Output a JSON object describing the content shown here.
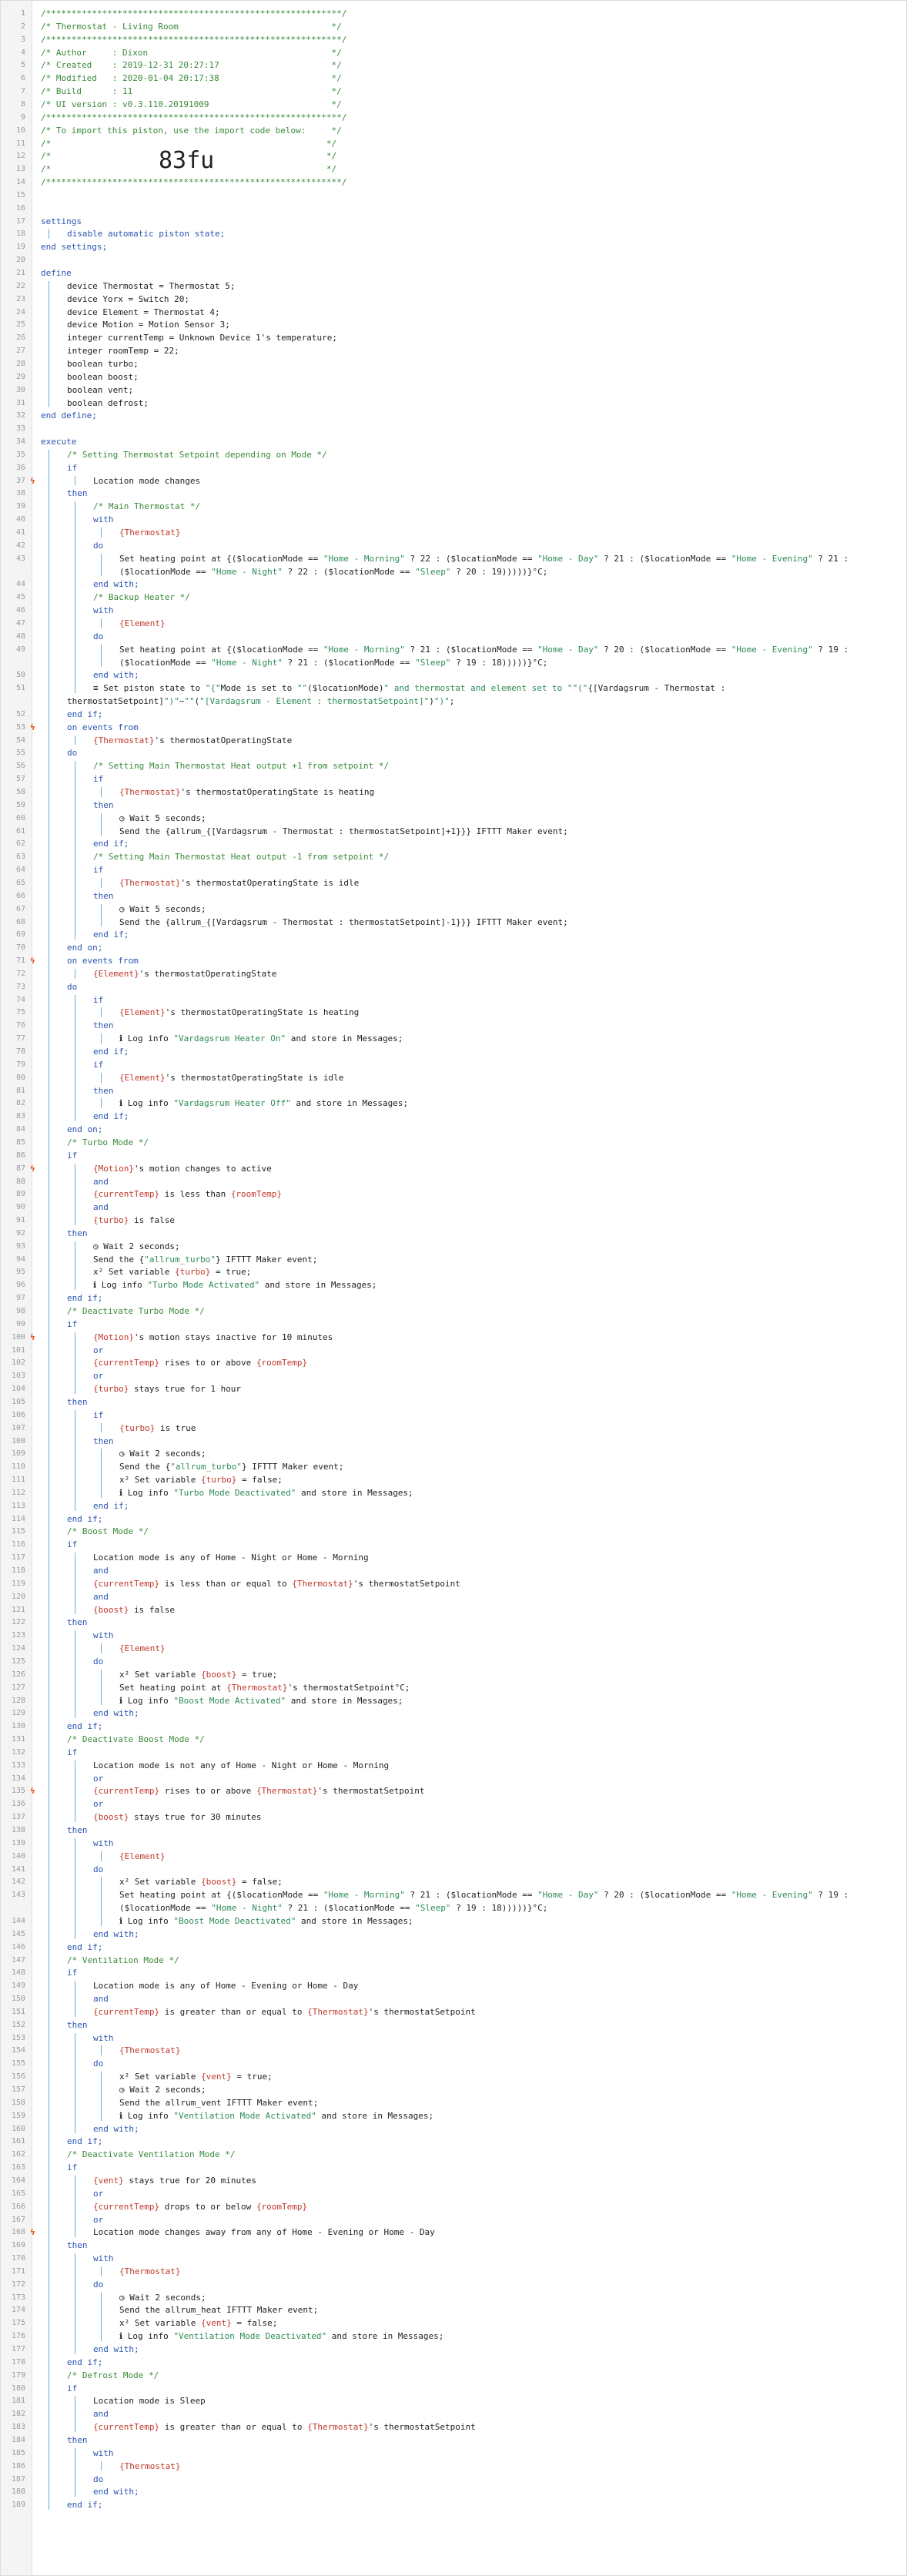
{
  "piston": {
    "title": "Thermostat - Living Room",
    "author": "Dixon",
    "created": "2019-12-31 20:27:17",
    "modified": "2020-01-04 20:17:38",
    "build": "11",
    "ui_version": "v0.3.110.20191009",
    "import_code": "83fu"
  },
  "lines": [
    {
      "n": "1",
      "ind": 0,
      "t": "/**********************************************************/",
      "c": "comment"
    },
    {
      "n": "2",
      "ind": 0,
      "t": "/* Thermostat - Living Room                              */",
      "c": "comment"
    },
    {
      "n": "3",
      "ind": 0,
      "t": "/**********************************************************/",
      "c": "comment"
    },
    {
      "n": "4",
      "ind": 0,
      "t": "/* Author     : Dixon                                    */",
      "c": "comment"
    },
    {
      "n": "5",
      "ind": 0,
      "t": "/* Created    : 2019-12-31 20:27:17                      */",
      "c": "comment"
    },
    {
      "n": "6",
      "ind": 0,
      "t": "/* Modified   : 2020-01-04 20:17:38                      */",
      "c": "comment"
    },
    {
      "n": "7",
      "ind": 0,
      "t": "/* Build      : 11                                       */",
      "c": "comment"
    },
    {
      "n": "8",
      "ind": 0,
      "t": "/* UI version : v0.3.110.20191009                        */",
      "c": "comment"
    },
    {
      "n": "9",
      "ind": 0,
      "t": "/**********************************************************/",
      "c": "comment"
    },
    {
      "n": "10",
      "ind": 0,
      "t": "/* To import this piston, use the import code below:     */",
      "c": "comment"
    },
    {
      "n": "11",
      "ind": 0,
      "t": "/*                                                      */",
      "c": "comment"
    },
    {
      "n": "12",
      "ind": 0,
      "t": "/*                                                      */",
      "c": "comment"
    },
    {
      "n": "13",
      "ind": 0,
      "t": "/*                                                      */",
      "c": "comment"
    },
    {
      "n": "14",
      "ind": 0,
      "t": "/**********************************************************/",
      "c": "comment"
    },
    {
      "n": "15",
      "ind": 0,
      "t": ""
    },
    {
      "n": "16",
      "ind": 0,
      "t": ""
    },
    {
      "n": "17",
      "ind": 0,
      "t": "settings",
      "c": "kw"
    },
    {
      "n": "18",
      "ind": 1,
      "t": "disable automatic piston state;",
      "c": "kw"
    },
    {
      "n": "19",
      "ind": 0,
      "t": "end settings;",
      "c": "kw"
    },
    {
      "n": "20",
      "ind": 0,
      "t": ""
    },
    {
      "n": "21",
      "ind": 0,
      "t": "define",
      "c": "kw"
    },
    {
      "n": "22",
      "ind": 1,
      "t": "device Thermostat = Thermostat 5;"
    },
    {
      "n": "23",
      "ind": 1,
      "t": "device Yorx = Switch 20;"
    },
    {
      "n": "24",
      "ind": 1,
      "t": "device Element = Thermostat 4;"
    },
    {
      "n": "25",
      "ind": 1,
      "t": "device Motion = Motion Sensor 3;"
    },
    {
      "n": "26",
      "ind": 1,
      "t": "integer currentTemp = Unknown Device 1's temperature;"
    },
    {
      "n": "27",
      "ind": 1,
      "t": "integer roomTemp = 22;"
    },
    {
      "n": "28",
      "ind": 1,
      "t": "boolean turbo;"
    },
    {
      "n": "29",
      "ind": 1,
      "t": "boolean boost;"
    },
    {
      "n": "30",
      "ind": 1,
      "t": "boolean vent;"
    },
    {
      "n": "31",
      "ind": 1,
      "t": "boolean defrost;"
    },
    {
      "n": "32",
      "ind": 0,
      "t": "end define;",
      "c": "kw"
    },
    {
      "n": "33",
      "ind": 0,
      "t": ""
    },
    {
      "n": "34",
      "ind": 0,
      "t": "execute",
      "c": "kw"
    },
    {
      "n": "35",
      "ind": 1,
      "t": "/* Setting Thermostat Setpoint depending on Mode */",
      "c": "comment"
    },
    {
      "n": "36",
      "ind": 1,
      "t": "if",
      "c": "kw"
    },
    {
      "n": "37",
      "ind": 2,
      "t": "Location mode changes",
      "m": "ϟ"
    },
    {
      "n": "38",
      "ind": 1,
      "t": "then",
      "c": "kw"
    },
    {
      "n": "39",
      "ind": 2,
      "t": "/* Main Thermostat */",
      "c": "comment"
    },
    {
      "n": "40",
      "ind": 2,
      "t": "with",
      "c": "kw"
    },
    {
      "n": "41",
      "ind": 3,
      "t": "{Thermostat}",
      "c": "var"
    },
    {
      "n": "42",
      "ind": 2,
      "t": "do",
      "c": "kw"
    },
    {
      "n": "43",
      "ind": 3,
      "t": "Set heating point at {($locationMode == \"Home - Morning\" ? 22 : ($locationMode == \"Home - Day\" ? 21 : ($locationMode == \"Home - Evening\" ? 21 :"
    },
    {
      "n": "",
      "ind": 3,
      "t": "($locationMode == \"Home - Night\" ? 22 : ($locationMode == \"Sleep\" ? 20 : 19)))))}°C;"
    },
    {
      "n": "44",
      "ind": 2,
      "t": "end with;",
      "c": "kw"
    },
    {
      "n": "45",
      "ind": 2,
      "t": "/* Backup Heater */",
      "c": "comment"
    },
    {
      "n": "46",
      "ind": 2,
      "t": "with",
      "c": "kw"
    },
    {
      "n": "47",
      "ind": 3,
      "t": "{Element}",
      "c": "var"
    },
    {
      "n": "48",
      "ind": 2,
      "t": "do",
      "c": "kw"
    },
    {
      "n": "49",
      "ind": 3,
      "t": "Set heating point at {($locationMode == \"Home - Morning\" ? 21 : ($locationMode == \"Home - Day\" ? 20 : ($locationMode == \"Home - Evening\" ? 19 :"
    },
    {
      "n": "",
      "ind": 3,
      "t": "($locationMode == \"Home - Night\" ? 21 : ($locationMode == \"Sleep\" ? 19 : 18)))))}°C;"
    },
    {
      "n": "50",
      "ind": 2,
      "t": "end with;",
      "c": "kw"
    },
    {
      "n": "51",
      "ind": 2,
      "t": "≡ Set piston state to \"{\"Mode is set to \"\"($locationMode)\" and thermostat and element set to \"\"(\"{[Vardagsrum - Thermostat :"
    },
    {
      "n": "",
      "ind": 1,
      "t": "thermostatSetpoint]\")\"~\"\"(\"[Vardagsrum - Element : thermostatSetpoint]\")\")\";"
    },
    {
      "n": "52",
      "ind": 1,
      "t": "end if;",
      "c": "kw"
    },
    {
      "n": "53",
      "ind": 1,
      "t": "on events from",
      "c": "kw",
      "m": "ϟ"
    },
    {
      "n": "54",
      "ind": 2,
      "t": "{Thermostat}'s thermostatOperatingState"
    },
    {
      "n": "55",
      "ind": 1,
      "t": "do",
      "c": "kw"
    },
    {
      "n": "56",
      "ind": 2,
      "t": "/* Setting Main Thermostat Heat output +1 from setpoint */",
      "c": "comment"
    },
    {
      "n": "57",
      "ind": 2,
      "t": "if",
      "c": "kw"
    },
    {
      "n": "58",
      "ind": 3,
      "t": "{Thermostat}'s thermostatOperatingState is heating"
    },
    {
      "n": "59",
      "ind": 2,
      "t": "then",
      "c": "kw"
    },
    {
      "n": "60",
      "ind": 3,
      "t": "◷ Wait 5 seconds;"
    },
    {
      "n": "61",
      "ind": 3,
      "t": "Send the {allrum_{[Vardagsrum - Thermostat : thermostatSetpoint]+1}}} IFTTT Maker event;"
    },
    {
      "n": "62",
      "ind": 2,
      "t": "end if;",
      "c": "kw"
    },
    {
      "n": "63",
      "ind": 2,
      "t": "/* Setting Main Thermostat Heat output -1 from setpoint */",
      "c": "comment"
    },
    {
      "n": "64",
      "ind": 2,
      "t": "if",
      "c": "kw"
    },
    {
      "n": "65",
      "ind": 3,
      "t": "{Thermostat}'s thermostatOperatingState is idle"
    },
    {
      "n": "66",
      "ind": 2,
      "t": "then",
      "c": "kw"
    },
    {
      "n": "67",
      "ind": 3,
      "t": "◷ Wait 5 seconds;"
    },
    {
      "n": "68",
      "ind": 3,
      "t": "Send the {allrum_{[Vardagsrum - Thermostat : thermostatSetpoint]-1}}} IFTTT Maker event;"
    },
    {
      "n": "69",
      "ind": 2,
      "t": "end if;",
      "c": "kw"
    },
    {
      "n": "70",
      "ind": 1,
      "t": "end on;",
      "c": "kw"
    },
    {
      "n": "71",
      "ind": 1,
      "t": "on events from",
      "c": "kw",
      "m": "ϟ"
    },
    {
      "n": "72",
      "ind": 2,
      "t": "{Element}'s thermostatOperatingState"
    },
    {
      "n": "73",
      "ind": 1,
      "t": "do",
      "c": "kw"
    },
    {
      "n": "74",
      "ind": 2,
      "t": "if",
      "c": "kw"
    },
    {
      "n": "75",
      "ind": 3,
      "t": "{Element}'s thermostatOperatingState is heating"
    },
    {
      "n": "76",
      "ind": 2,
      "t": "then",
      "c": "kw"
    },
    {
      "n": "77",
      "ind": 3,
      "t": "ℹ Log info \"Vardagsrum Heater On\" and store in Messages;"
    },
    {
      "n": "78",
      "ind": 2,
      "t": "end if;",
      "c": "kw"
    },
    {
      "n": "79",
      "ind": 2,
      "t": "if",
      "c": "kw"
    },
    {
      "n": "80",
      "ind": 3,
      "t": "{Element}'s thermostatOperatingState is idle"
    },
    {
      "n": "81",
      "ind": 2,
      "t": "then",
      "c": "kw"
    },
    {
      "n": "82",
      "ind": 3,
      "t": "ℹ Log info \"Vardagsrum Heater Off\" and store in Messages;"
    },
    {
      "n": "83",
      "ind": 2,
      "t": "end if;",
      "c": "kw"
    },
    {
      "n": "84",
      "ind": 1,
      "t": "end on;",
      "c": "kw"
    },
    {
      "n": "85",
      "ind": 1,
      "t": "/* Turbo Mode */",
      "c": "comment"
    },
    {
      "n": "86",
      "ind": 1,
      "t": "if",
      "c": "kw"
    },
    {
      "n": "87",
      "ind": 2,
      "t": "{Motion}'s motion changes to active",
      "m": "ϟ"
    },
    {
      "n": "88",
      "ind": 2,
      "t": "and",
      "c": "kw"
    },
    {
      "n": "89",
      "ind": 2,
      "t": "{currentTemp} is less than {roomTemp}"
    },
    {
      "n": "90",
      "ind": 2,
      "t": "and",
      "c": "kw"
    },
    {
      "n": "91",
      "ind": 2,
      "t": "{turbo} is false"
    },
    {
      "n": "92",
      "ind": 1,
      "t": "then",
      "c": "kw"
    },
    {
      "n": "93",
      "ind": 2,
      "t": "◷ Wait 2 seconds;"
    },
    {
      "n": "94",
      "ind": 2,
      "t": "Send the {\"allrum_turbo\"} IFTTT Maker event;"
    },
    {
      "n": "95",
      "ind": 2,
      "t": "x² Set variable {turbo} = true;"
    },
    {
      "n": "96",
      "ind": 2,
      "t": "ℹ Log info \"Turbo Mode Activated\" and store in Messages;"
    },
    {
      "n": "97",
      "ind": 1,
      "t": "end if;",
      "c": "kw"
    },
    {
      "n": "98",
      "ind": 1,
      "t": "/* Deactivate Turbo Mode */",
      "c": "comment"
    },
    {
      "n": "99",
      "ind": 1,
      "t": "if",
      "c": "kw"
    },
    {
      "n": "100",
      "ind": 2,
      "t": "{Motion}'s motion stays inactive for 10 minutes",
      "m": "ϟ"
    },
    {
      "n": "101",
      "ind": 2,
      "t": "or",
      "c": "kw"
    },
    {
      "n": "102",
      "ind": 2,
      "t": "{currentTemp} rises to or above {roomTemp}"
    },
    {
      "n": "103",
      "ind": 2,
      "t": "or",
      "c": "kw"
    },
    {
      "n": "104",
      "ind": 2,
      "t": "{turbo} stays true for 1 hour"
    },
    {
      "n": "105",
      "ind": 1,
      "t": "then",
      "c": "kw"
    },
    {
      "n": "106",
      "ind": 2,
      "t": "if",
      "c": "kw"
    },
    {
      "n": "107",
      "ind": 3,
      "t": "{turbo} is true"
    },
    {
      "n": "108",
      "ind": 2,
      "t": "then",
      "c": "kw"
    },
    {
      "n": "109",
      "ind": 3,
      "t": "◷ Wait 2 seconds;"
    },
    {
      "n": "110",
      "ind": 3,
      "t": "Send the {\"allrum_turbo\"} IFTTT Maker event;"
    },
    {
      "n": "111",
      "ind": 3,
      "t": "x² Set variable {turbo} = false;"
    },
    {
      "n": "112",
      "ind": 3,
      "t": "ℹ Log info \"Turbo Mode Deactivated\" and store in Messages;"
    },
    {
      "n": "113",
      "ind": 2,
      "t": "end if;",
      "c": "kw"
    },
    {
      "n": "114",
      "ind": 1,
      "t": "end if;",
      "c": "kw"
    },
    {
      "n": "115",
      "ind": 1,
      "t": "/* Boost Mode */",
      "c": "comment"
    },
    {
      "n": "116",
      "ind": 1,
      "t": "if",
      "c": "kw"
    },
    {
      "n": "117",
      "ind": 2,
      "t": "Location mode is any of Home - Night or Home - Morning"
    },
    {
      "n": "118",
      "ind": 2,
      "t": "and",
      "c": "kw"
    },
    {
      "n": "119",
      "ind": 2,
      "t": "{currentTemp} is less than or equal to {Thermostat}'s thermostatSetpoint"
    },
    {
      "n": "120",
      "ind": 2,
      "t": "and",
      "c": "kw"
    },
    {
      "n": "121",
      "ind": 2,
      "t": "{boost} is false"
    },
    {
      "n": "122",
      "ind": 1,
      "t": "then",
      "c": "kw"
    },
    {
      "n": "123",
      "ind": 2,
      "t": "with",
      "c": "kw"
    },
    {
      "n": "124",
      "ind": 3,
      "t": "{Element}",
      "c": "var"
    },
    {
      "n": "125",
      "ind": 2,
      "t": "do",
      "c": "kw"
    },
    {
      "n": "126",
      "ind": 3,
      "t": "x² Set variable {boost} = true;"
    },
    {
      "n": "127",
      "ind": 3,
      "t": "Set heating point at {Thermostat}'s thermostatSetpoint°C;"
    },
    {
      "n": "128",
      "ind": 3,
      "t": "ℹ Log info \"Boost Mode Activated\" and store in Messages;"
    },
    {
      "n": "129",
      "ind": 2,
      "t": "end with;",
      "c": "kw"
    },
    {
      "n": "130",
      "ind": 1,
      "t": "end if;",
      "c": "kw"
    },
    {
      "n": "131",
      "ind": 1,
      "t": "/* Deactivate Boost Mode */",
      "c": "comment"
    },
    {
      "n": "132",
      "ind": 1,
      "t": "if",
      "c": "kw"
    },
    {
      "n": "133",
      "ind": 2,
      "t": "Location mode is not any of Home - Night or Home - Morning"
    },
    {
      "n": "134",
      "ind": 2,
      "t": "or",
      "c": "kw"
    },
    {
      "n": "135",
      "ind": 2,
      "t": "{currentTemp} rises to or above {Thermostat}'s thermostatSetpoint",
      "m": "ϟ"
    },
    {
      "n": "136",
      "ind": 2,
      "t": "or",
      "c": "kw"
    },
    {
      "n": "137",
      "ind": 2,
      "t": "{boost} stays true for 30 minutes"
    },
    {
      "n": "138",
      "ind": 1,
      "t": "then",
      "c": "kw"
    },
    {
      "n": "139",
      "ind": 2,
      "t": "with",
      "c": "kw"
    },
    {
      "n": "140",
      "ind": 3,
      "t": "{Element}",
      "c": "var"
    },
    {
      "n": "141",
      "ind": 2,
      "t": "do",
      "c": "kw"
    },
    {
      "n": "142",
      "ind": 3,
      "t": "x² Set variable {boost} = false;"
    },
    {
      "n": "143",
      "ind": 3,
      "t": "Set heating point at {($locationMode == \"Home - Morning\" ? 21 : ($locationMode == \"Home - Day\" ? 20 : ($locationMode == \"Home - Evening\" ? 19 :"
    },
    {
      "n": "",
      "ind": 3,
      "t": "($locationMode == \"Home - Night\" ? 21 : ($locationMode == \"Sleep\" ? 19 : 18)))))}°C;"
    },
    {
      "n": "144",
      "ind": 3,
      "t": "ℹ Log info \"Boost Mode Deactivated\" and store in Messages;"
    },
    {
      "n": "145",
      "ind": 2,
      "t": "end with;",
      "c": "kw"
    },
    {
      "n": "146",
      "ind": 1,
      "t": "end if;",
      "c": "kw"
    },
    {
      "n": "147",
      "ind": 1,
      "t": "/* Ventilation Mode */",
      "c": "comment"
    },
    {
      "n": "148",
      "ind": 1,
      "t": "if",
      "c": "kw"
    },
    {
      "n": "149",
      "ind": 2,
      "t": "Location mode is any of Home - Evening or Home - Day"
    },
    {
      "n": "150",
      "ind": 2,
      "t": "and",
      "c": "kw"
    },
    {
      "n": "151",
      "ind": 2,
      "t": "{currentTemp} is greater than or equal to {Thermostat}'s thermostatSetpoint"
    },
    {
      "n": "152",
      "ind": 1,
      "t": "then",
      "c": "kw"
    },
    {
      "n": "153",
      "ind": 2,
      "t": "with",
      "c": "kw"
    },
    {
      "n": "154",
      "ind": 3,
      "t": "{Thermostat}",
      "c": "var"
    },
    {
      "n": "155",
      "ind": 2,
      "t": "do",
      "c": "kw"
    },
    {
      "n": "156",
      "ind": 3,
      "t": "x² Set variable {vent} = true;"
    },
    {
      "n": "157",
      "ind": 3,
      "t": "◷ Wait 2 seconds;"
    },
    {
      "n": "158",
      "ind": 3,
      "t": "Send the allrum_vent IFTTT Maker event;"
    },
    {
      "n": "159",
      "ind": 3,
      "t": "ℹ Log info \"Ventilation Mode Activated\" and store in Messages;"
    },
    {
      "n": "160",
      "ind": 2,
      "t": "end with;",
      "c": "kw"
    },
    {
      "n": "161",
      "ind": 1,
      "t": "end if;",
      "c": "kw"
    },
    {
      "n": "162",
      "ind": 1,
      "t": "/* Deactivate Ventilation Mode */",
      "c": "comment"
    },
    {
      "n": "163",
      "ind": 1,
      "t": "if",
      "c": "kw"
    },
    {
      "n": "164",
      "ind": 2,
      "t": "{vent} stays true for 20 minutes"
    },
    {
      "n": "165",
      "ind": 2,
      "t": "or",
      "c": "kw"
    },
    {
      "n": "166",
      "ind": 2,
      "t": "{currentTemp} drops to or below {roomTemp}"
    },
    {
      "n": "167",
      "ind": 2,
      "t": "or",
      "c": "kw"
    },
    {
      "n": "168",
      "ind": 2,
      "t": "Location mode changes away from any of Home - Evening or Home - Day",
      "m": "ϟ"
    },
    {
      "n": "169",
      "ind": 1,
      "t": "then",
      "c": "kw"
    },
    {
      "n": "170",
      "ind": 2,
      "t": "with",
      "c": "kw"
    },
    {
      "n": "171",
      "ind": 3,
      "t": "{Thermostat}",
      "c": "var"
    },
    {
      "n": "172",
      "ind": 2,
      "t": "do",
      "c": "kw"
    },
    {
      "n": "173",
      "ind": 3,
      "t": "◷ Wait 2 seconds;"
    },
    {
      "n": "174",
      "ind": 3,
      "t": "Send the allrum_heat IFTTT Maker event;"
    },
    {
      "n": "175",
      "ind": 3,
      "t": "x² Set variable {vent} = false;"
    },
    {
      "n": "176",
      "ind": 3,
      "t": "ℹ Log info \"Ventilation Mode Deactivated\" and store in Messages;"
    },
    {
      "n": "177",
      "ind": 2,
      "t": "end with;",
      "c": "kw"
    },
    {
      "n": "178",
      "ind": 1,
      "t": "end if;",
      "c": "kw"
    },
    {
      "n": "179",
      "ind": 1,
      "t": "/* Defrost Mode */",
      "c": "comment"
    },
    {
      "n": "180",
      "ind": 1,
      "t": "if",
      "c": "kw"
    },
    {
      "n": "181",
      "ind": 2,
      "t": "Location mode is Sleep"
    },
    {
      "n": "182",
      "ind": 2,
      "t": "and",
      "c": "kw"
    },
    {
      "n": "183",
      "ind": 2,
      "t": "{currentTemp} is greater than or equal to {Thermostat}'s thermostatSetpoint"
    },
    {
      "n": "184",
      "ind": 1,
      "t": "then",
      "c": "kw"
    },
    {
      "n": "185",
      "ind": 2,
      "t": "with",
      "c": "kw"
    },
    {
      "n": "186",
      "ind": 3,
      "t": "{Thermostat}",
      "c": "var"
    },
    {
      "n": "187",
      "ind": 2,
      "t": "do",
      "c": "kw"
    },
    {
      "n": "188",
      "ind": 2,
      "t": "end with;",
      "c": "kw"
    },
    {
      "n": "189",
      "ind": 1,
      "t": "end if;",
      "c": "kw"
    }
  ],
  "colors": {
    "comment": "#3a8a3a",
    "keyword": "#2a55b0",
    "variable": "#c0392b",
    "gutter": "#f4f4f4",
    "guide": "#6aaed6",
    "trigger_mark": "#e05a1a"
  }
}
